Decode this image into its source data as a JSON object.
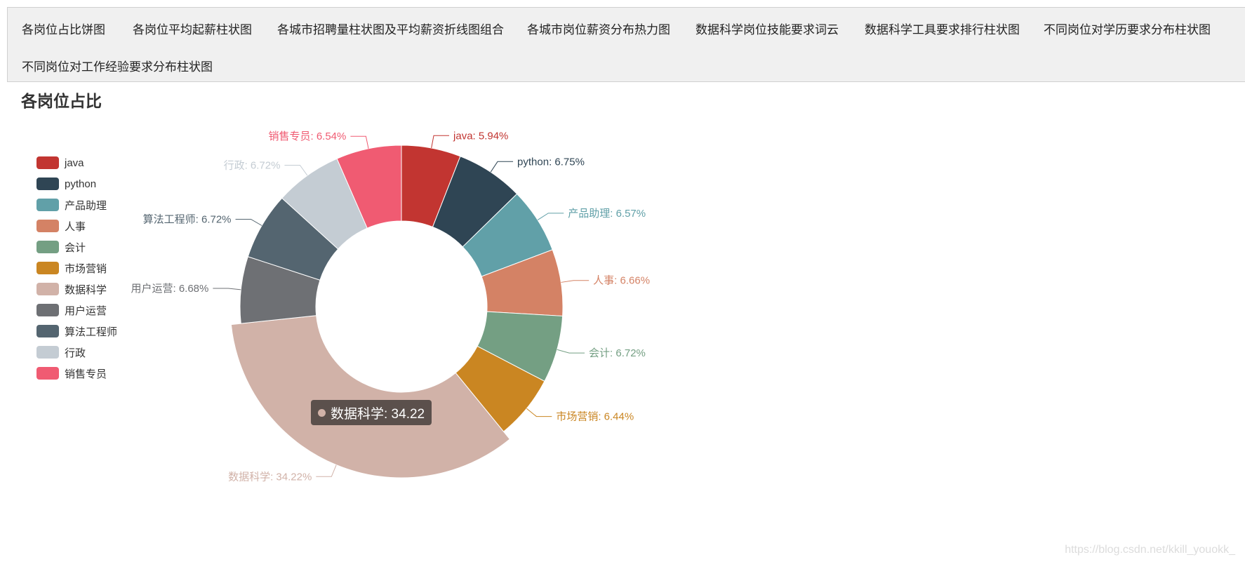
{
  "nav": {
    "items": [
      "各岗位占比饼图",
      "各岗位平均起薪柱状图",
      "各城市招聘量柱状图及平均薪资折线图组合",
      "各城市岗位薪资分布热力图",
      "数据科学岗位技能要求词云",
      "数据科学工具要求排行柱状图",
      "不同岗位对学历要求分布柱状图",
      "不同岗位对工作经验要求分布柱状图"
    ]
  },
  "page": {
    "title": "各岗位占比"
  },
  "tooltip": {
    "text": "数据科学: 34.22",
    "color": "#d1b2a8"
  },
  "watermark": "https://blog.csdn.net/kkill_youokk_",
  "chart_data": {
    "type": "pie",
    "title": "各岗位占比",
    "donut": true,
    "legend_position": "left",
    "emphasized_slice": "数据科学",
    "slices": [
      {
        "name": "java",
        "value": 5.94,
        "label": "java: 5.94%",
        "color": "#c23531"
      },
      {
        "name": "python",
        "value": 6.75,
        "label": "python: 6.75%",
        "color": "#2f4554"
      },
      {
        "name": "产品助理",
        "value": 6.57,
        "label": "产品助理: 6.57%",
        "color": "#61a0a8"
      },
      {
        "name": "人事",
        "value": 6.66,
        "label": "人事: 6.66%",
        "color": "#d48265"
      },
      {
        "name": "会计",
        "value": 6.72,
        "label": "会计: 6.72%",
        "color": "#749f83"
      },
      {
        "name": "市场营销",
        "value": 6.44,
        "label": "市场营销: 6.44%",
        "color": "#ca8622"
      },
      {
        "name": "数据科学",
        "value": 34.22,
        "label": "数据科学: 34.22%",
        "color": "#d1b2a8"
      },
      {
        "name": "用户运营",
        "value": 6.68,
        "label": "用户运营: 6.68%",
        "color": "#6e7074"
      },
      {
        "name": "算法工程师",
        "value": 6.72,
        "label": "算法工程师: 6.72%",
        "color": "#546570"
      },
      {
        "name": "行政",
        "value": 6.72,
        "label": "行政: 6.72%",
        "color": "#c4ccd3"
      },
      {
        "name": "销售专员",
        "value": 6.54,
        "label": "销售专员: 6.54%",
        "color": "#f05b72"
      }
    ]
  }
}
